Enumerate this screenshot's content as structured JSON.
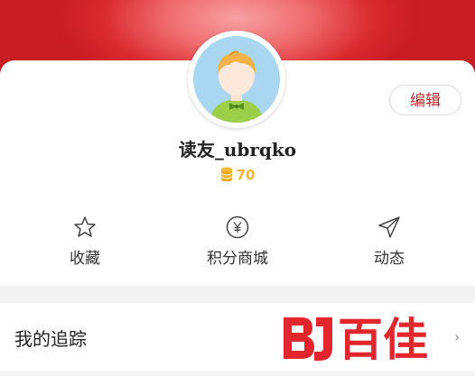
{
  "profile": {
    "username": "读友_ubrqko",
    "points": "70",
    "edit_label": "编辑"
  },
  "actions": [
    {
      "label": "收藏",
      "icon": "star-icon"
    },
    {
      "label": "积分商城",
      "icon": "yen-coin-icon"
    },
    {
      "label": "动态",
      "icon": "paper-plane-icon"
    }
  ],
  "list": {
    "following_label": "我的追踪"
  },
  "watermark": {
    "text": "百佳"
  },
  "colors": {
    "brand_red": "#c81d23",
    "points_gold": "#f2b52b",
    "background": "#f2f2f2"
  }
}
